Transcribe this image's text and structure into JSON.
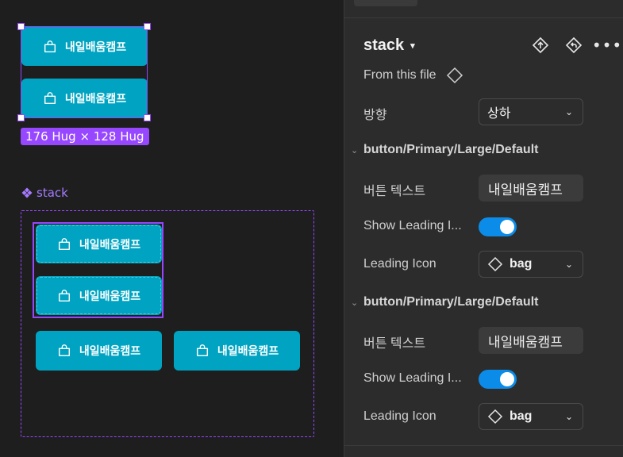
{
  "canvas": {
    "top_buttons": [
      {
        "label": "내일배움캠프"
      },
      {
        "label": "내일배움캠프"
      }
    ],
    "size_badge": "176 Hug × 128 Hug",
    "frame_label": "stack",
    "frame_buttons": [
      {
        "label": "내일배움캠프"
      },
      {
        "label": "내일배움캠프"
      },
      {
        "label": "내일배움캠프"
      },
      {
        "label": "내일배움캠프"
      }
    ]
  },
  "panel": {
    "component_name": "stack",
    "source_label": "From this file",
    "direction_label": "방향",
    "direction_value": "상하",
    "sections": [
      {
        "title": "button/Primary/Large/Default",
        "text_label": "버튼 텍스트",
        "text_value": "내일배움캠프",
        "show_leading_label": "Show Leading I...",
        "show_leading_on": true,
        "leading_icon_label": "Leading Icon",
        "leading_icon_value": "bag"
      },
      {
        "title": "button/Primary/Large/Default",
        "text_label": "버튼 텍스트",
        "text_value": "내일배움캠프",
        "show_leading_label": "Show Leading I...",
        "show_leading_on": true,
        "leading_icon_label": "Leading Icon",
        "leading_icon_value": "bag"
      }
    ]
  },
  "colors": {
    "button": "#00a4c2",
    "selection": "#9747ff",
    "toggle": "#0c8ce9"
  }
}
